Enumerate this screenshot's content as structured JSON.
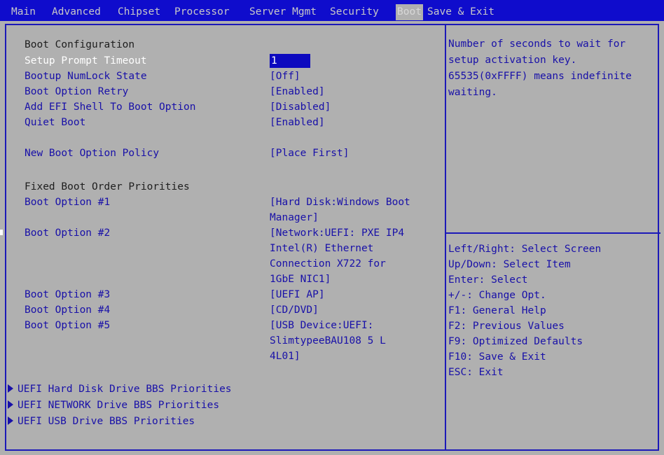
{
  "tabs": [
    "Main",
    "Advanced",
    "Chipset",
    "Processor",
    "Server Mgmt",
    "Security",
    "Boot",
    "Save & Exit"
  ],
  "sections": {
    "boot_configuration": "Boot Configuration",
    "fixed_boot_order": "Fixed Boot Order Priorities"
  },
  "settings": {
    "setup_prompt_timeout": {
      "label": "Setup Prompt Timeout",
      "value": "1"
    },
    "bootup_numlock": {
      "label": "Bootup NumLock State",
      "value": "[Off]"
    },
    "boot_option_retry": {
      "label": "Boot Option Retry",
      "value": "[Enabled]"
    },
    "add_efi_shell": {
      "label": "Add EFI Shell To Boot Option",
      "value": "[Disabled]"
    },
    "quiet_boot": {
      "label": "Quiet Boot",
      "value": "[Enabled]"
    },
    "new_boot_option_policy": {
      "label": "New Boot Option Policy",
      "value": "[Place First]"
    }
  },
  "boot_options": {
    "opt1": {
      "label": "Boot Option #1",
      "lines": [
        "[Hard Disk:Windows Boot",
        "Manager]"
      ]
    },
    "opt2": {
      "label": "Boot Option #2",
      "lines": [
        "[Network:UEFI: PXE IP4",
        "Intel(R) Ethernet",
        "Connection X722 for",
        "1GbE NIC1]"
      ]
    },
    "opt3": {
      "label": "Boot Option #3",
      "lines": [
        "[UEFI AP]"
      ]
    },
    "opt4": {
      "label": "Boot Option #4",
      "lines": [
        "[CD/DVD]"
      ]
    },
    "opt5": {
      "label": "Boot Option #5",
      "lines": [
        "[USB Device:UEFI:",
        "SlimtypeeBAU108 5 L",
        "4L01]"
      ]
    }
  },
  "submenus": [
    "UEFI Hard Disk Drive BBS Priorities",
    "UEFI NETWORK Drive BBS Priorities",
    "UEFI USB Drive BBS Priorities"
  ],
  "help_text": [
    "Number of seconds to wait for",
    "setup activation key.",
    "65535(0xFFFF) means indefinite",
    "waiting."
  ],
  "key_help": [
    "Left/Right: Select Screen",
    "Up/Down: Select Item",
    "Enter: Select",
    "+/-: Change Opt.",
    "F1: General Help",
    "F2: Previous Values",
    "F9: Optimized Defaults",
    "F10: Save & Exit",
    "ESC: Exit"
  ],
  "colors": {
    "background": "#b0b0b0",
    "header_bar": "#0f0ccc",
    "accent_text": "#1810a8",
    "border": "#1c19b8",
    "selected_value_bg": "#0c09bf"
  }
}
